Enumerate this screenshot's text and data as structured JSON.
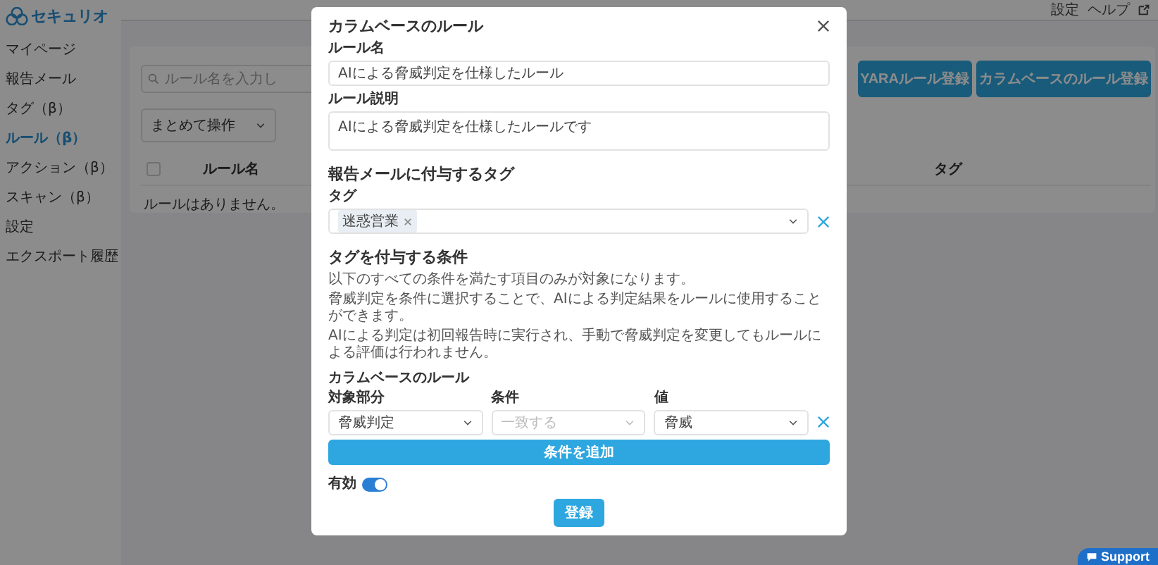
{
  "header": {
    "links": [
      "設定",
      "ヘルプ"
    ]
  },
  "sidebar": {
    "logo": "セキュリオ",
    "items": [
      {
        "label": "マイページ",
        "selected": false
      },
      {
        "label": "報告メール",
        "selected": false
      },
      {
        "label": "タグ（β）",
        "selected": false
      },
      {
        "label": "ルール（β）",
        "selected": true
      },
      {
        "label": "アクション（β）",
        "selected": false
      },
      {
        "label": "スキャン（β）",
        "selected": false
      },
      {
        "label": "設定",
        "selected": false
      },
      {
        "label": "エクスポート履歴",
        "selected": false
      }
    ]
  },
  "main": {
    "search": {
      "placeholder": "ルール名を入力し"
    },
    "buttons": [
      "YARAルール登録",
      "カラムベースのルール登録"
    ],
    "bulk_action": "まとめて操作",
    "table": {
      "select_all_checked": false,
      "columns": [
        "ルール名",
        "タグ"
      ],
      "empty_message": "ルールはありません。"
    }
  },
  "modal": {
    "title": "カラムベースのルール",
    "fields": [
      {
        "kind": "input",
        "label": "ルール名",
        "value": "AIによる脅威判定を仕様したルール"
      },
      {
        "kind": "textarea",
        "label": "ルール説明",
        "value": "AIによる脅威判定を仕様したルールです"
      }
    ],
    "tag_section": {
      "heading": "報告メールに付与するタグ",
      "label": "タグ",
      "tags": [
        "迷惑営業"
      ]
    },
    "condition_section": {
      "heading": "タグを付与する条件",
      "notes": [
        "以下のすべての条件を満たす項目のみが対象になります。",
        "脅威判定を条件に選択することで、AIによる判定結果をルールに使用することができます。",
        "AIによる判定は初回報告時に実行され、手動で脅威判定を変更してもルールによる評価は行われません。"
      ],
      "rule_group": "カラムベースのルール",
      "columns": [
        "対象部分",
        "条件",
        "値"
      ],
      "cells": [
        {
          "value": "脅威判定",
          "disabled": false
        },
        {
          "value": "一致する",
          "disabled": true
        },
        {
          "value": "脅威",
          "disabled": false
        }
      ],
      "add_button": "条件を追加"
    },
    "enabled": {
      "label": "有効",
      "on": true
    },
    "submit": "登録"
  },
  "support": {
    "label": "Support"
  }
}
